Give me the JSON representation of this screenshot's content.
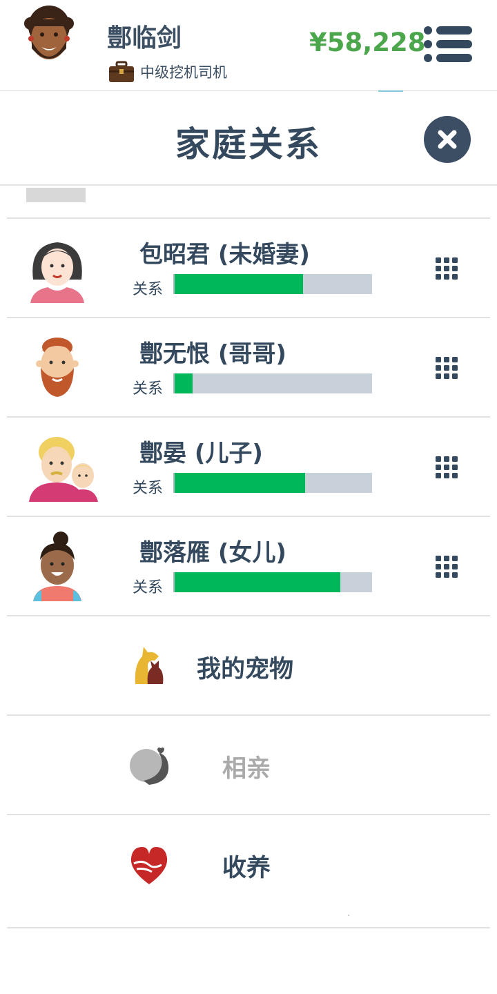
{
  "header": {
    "player_name": "鄷临剑",
    "job_title": "中级挖机司机",
    "money": "¥58,228",
    "money_color": "#4ca64c",
    "avatar_icon": "bearded-man-avatar-icon",
    "job_icon": "briefcase-icon",
    "menu_icon": "list-menu-icon"
  },
  "page": {
    "title": "家庭关系",
    "close_icon": "close-x-icon"
  },
  "relationship_label": "关系",
  "family": [
    {
      "name": "包昭君 (未婚妻)",
      "relation_level": 0.65,
      "avatar_icon": "woman-avatar-icon"
    },
    {
      "name": "鄷无恨 (哥哥)",
      "relation_level": 0.09,
      "avatar_icon": "red-bearded-man-avatar-icon"
    },
    {
      "name": "鄷晏 (儿子)",
      "relation_level": 0.66,
      "avatar_icon": "father-and-child-avatar-icon"
    },
    {
      "name": "鄷落雁 (女儿)",
      "relation_level": 0.84,
      "avatar_icon": "girl-avatar-icon"
    }
  ],
  "actions": [
    {
      "label": "我的宠物",
      "icon": "dog-and-cat-icon",
      "enabled": true
    },
    {
      "label": "相亲",
      "icon": "couple-silhouette-icon",
      "enabled": false
    },
    {
      "label": "收养",
      "icon": "heart-hands-icon",
      "enabled": true
    }
  ],
  "colors": {
    "bar_fill": "#00b859",
    "bar_track": "#c8d0da",
    "text_dark": "#34495e",
    "text_disabled": "#aaaaaa"
  }
}
